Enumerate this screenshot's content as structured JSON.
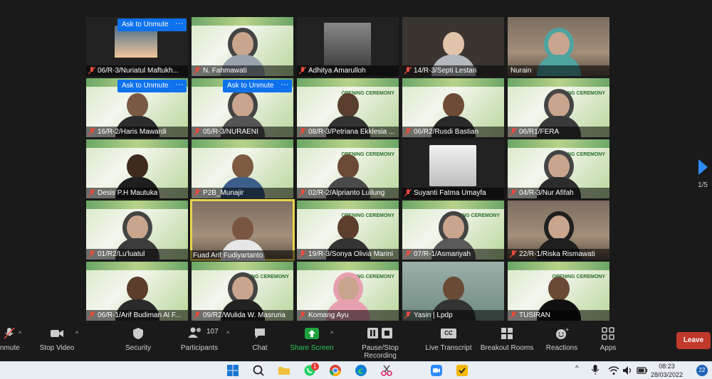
{
  "gallery": {
    "tiles": [
      {
        "name": "06/R-3/Nuriatul Maftukh...",
        "muted": true
      },
      {
        "name": "N. Fahmawati",
        "muted": true
      },
      {
        "name": "Adhitya Amarulloh",
        "muted": true
      },
      {
        "name": "14/R-3/Septi Lestari",
        "muted": true
      },
      {
        "name": "Nurain",
        "muted": false
      },
      {
        "name": "16/R-2/Haris Mawardi",
        "muted": true
      },
      {
        "name": "05/R-3/NURAENI",
        "muted": true
      },
      {
        "name": "08/R-3/Petriana Ekklesia ...",
        "muted": true
      },
      {
        "name": "06/R2/Rusdi Bastian",
        "muted": true
      },
      {
        "name": "06/R1/FERA",
        "muted": true
      },
      {
        "name": "Desis P.H Mautuka",
        "muted": true
      },
      {
        "name": "P2B_Munajir",
        "muted": true
      },
      {
        "name": "02/R-2/Alprianto Luilung",
        "muted": true
      },
      {
        "name": "Suyanti Fatma Umayfa",
        "muted": true
      },
      {
        "name": "04/R-3/Nur Afifah",
        "muted": true
      },
      {
        "name": "01/R2/Lu'luatul",
        "muted": true
      },
      {
        "name": "Fuad Arif Fudiyartanto",
        "muted": false
      },
      {
        "name": "19/R-3/Sonya Olivia Marini",
        "muted": true
      },
      {
        "name": "07/R-1/Asmariyah",
        "muted": true
      },
      {
        "name": "22/R-1/Riska Rismawati",
        "muted": true
      },
      {
        "name": "06/R-1/Arif Budiman Al F...",
        "muted": true
      },
      {
        "name": "09/R2/Wulida W. Masruria",
        "muted": true
      },
      {
        "name": "Komang Ayu",
        "muted": true
      },
      {
        "name": "Yasin | Lpdp",
        "muted": true
      },
      {
        "name": "TUSIRAN",
        "muted": true
      }
    ],
    "ask_to_unmute": "Ask to Unmute",
    "more_dots": "···",
    "banner_title": "OPENING CEREMONY",
    "page_indicator": "1/5"
  },
  "toolbar": {
    "unmute": "nmute",
    "stop_video": "Stop Video",
    "security": "Security",
    "participants": "Participants",
    "participants_count": "107",
    "chat": "Chat",
    "share_screen": "Share Screen",
    "pause_stop_recording": "Pause/Stop Recording",
    "live_transcript": "Live Transcript",
    "cc_badge": "CC",
    "breakout_rooms": "Breakout Rooms",
    "reactions": "Reactions",
    "apps": "Apps",
    "leave": "Leave"
  },
  "taskbar": {
    "whatsapp_badge": "1",
    "time": "08:23",
    "date": "28/03/2022",
    "notifications": "22"
  }
}
